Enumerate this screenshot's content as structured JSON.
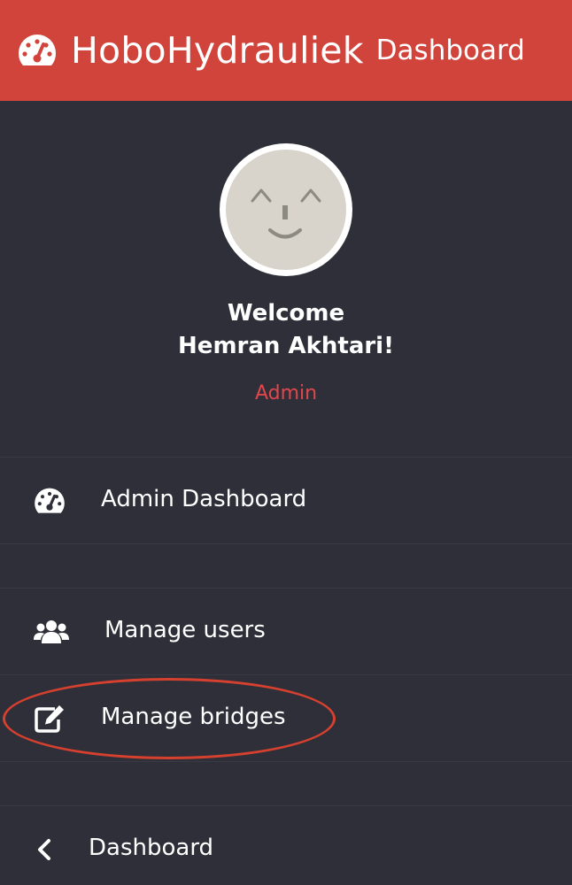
{
  "header": {
    "brand": "HoboHydrauliek",
    "subtitle": "Dashboard",
    "icon": "tachometer-icon",
    "background": "#d0443c"
  },
  "profile": {
    "welcome_line1": "Welcome",
    "welcome_line2": "Hemran Akhtari!",
    "role": "Admin",
    "role_color": "#e0474d"
  },
  "nav": {
    "admin_dashboard": {
      "label": "Admin Dashboard",
      "icon": "tachometer-icon"
    },
    "manage_users": {
      "label": "Manage users",
      "icon": "users-icon"
    },
    "manage_bridges": {
      "label": "Manage bridges",
      "icon": "edit-icon"
    },
    "back_dashboard": {
      "label": "Dashboard",
      "icon": "chevron-left-icon"
    }
  },
  "colors": {
    "sidebar_background": "#2e2f38",
    "highlight": "#d6402f"
  }
}
